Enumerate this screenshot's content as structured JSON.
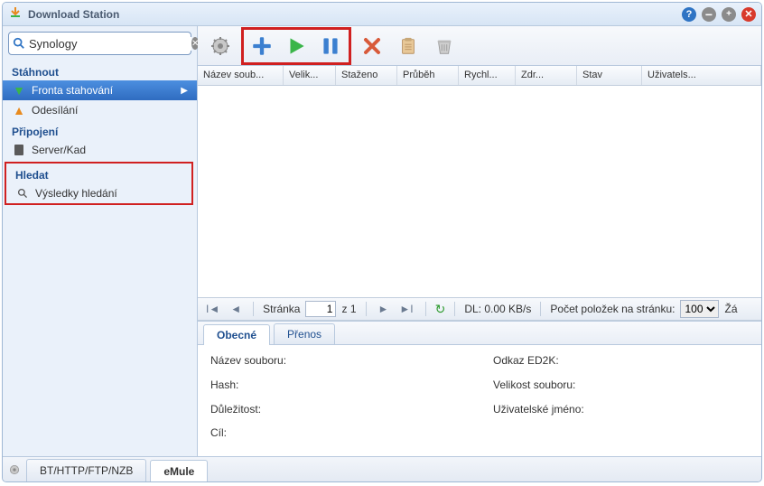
{
  "window": {
    "title": "Download Station"
  },
  "search": {
    "value": "Synology",
    "placeholder": ""
  },
  "sidebar": {
    "groups": [
      {
        "title": "Stáhnout",
        "items": [
          {
            "label": "Fronta stahování",
            "icon": "arrow-down-icon",
            "selected": true,
            "chevron": true
          },
          {
            "label": "Odesílání",
            "icon": "arrow-up-icon"
          }
        ]
      },
      {
        "title": "Připojení",
        "items": [
          {
            "label": "Server/Kad",
            "icon": "server-icon"
          }
        ]
      },
      {
        "title": "Hledat",
        "items": [
          {
            "label": "Výsledky hledání",
            "icon": "magnifier-icon"
          }
        ],
        "highlighted": true
      }
    ]
  },
  "toolbar": {
    "buttons": [
      "settings",
      "add",
      "start",
      "pause",
      "delete",
      "clipboard",
      "clear-completed"
    ]
  },
  "columns": [
    "Název soub...",
    "Velik...",
    "Staženo",
    "Průběh",
    "Rychl...",
    "Zdr...",
    "Stav",
    "Uživatels..."
  ],
  "pager": {
    "page_label": "Stránka",
    "page": "1",
    "of_sep": "z",
    "total_pages": "1",
    "dl_label": "DL: 0.00 KB/s",
    "perpage_label": "Počet položek na stránku:",
    "perpage": "100",
    "overflow": "Žá"
  },
  "details": {
    "tabs": [
      "Obecné",
      "Přenos"
    ],
    "fields": {
      "name": "Název souboru:",
      "ed2k": "Odkaz ED2K:",
      "hash": "Hash:",
      "size": "Velikost souboru:",
      "priority": "Důležitost:",
      "user": "Uživatelské jméno:",
      "dest": "Cíl:"
    }
  },
  "footer": {
    "tabs": [
      "BT/HTTP/FTP/NZB",
      "eMule"
    ],
    "active": 1
  }
}
